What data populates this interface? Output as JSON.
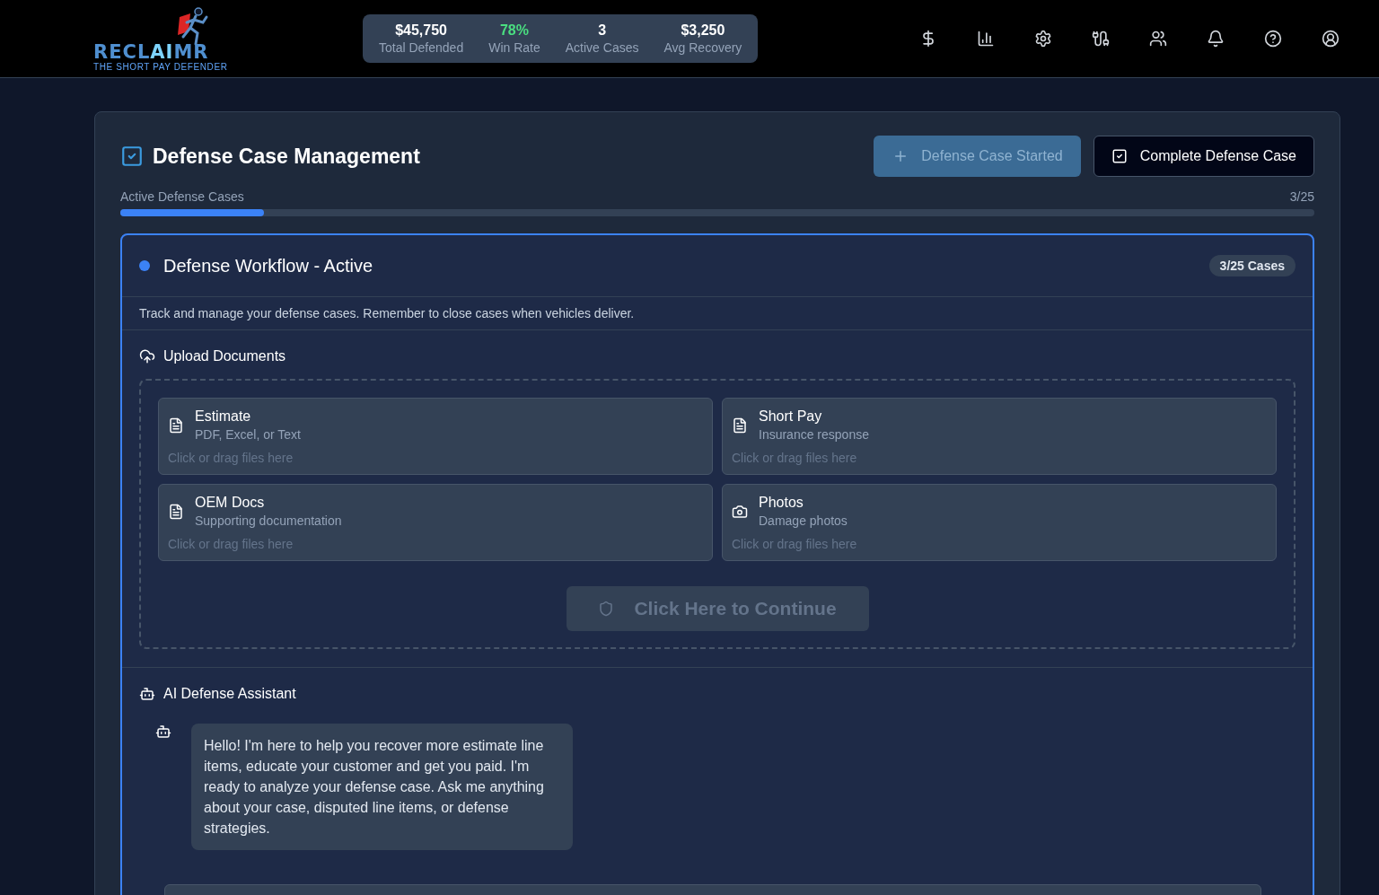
{
  "logo": {
    "word_parts": [
      {
        "text": "RECL",
        "accent": false
      },
      {
        "text": "AI",
        "accent": true
      },
      {
        "text": "MR",
        "accent": false
      }
    ],
    "tagline": "THE SHORT PAY DEFENDER"
  },
  "stats": [
    {
      "value": "$45,750",
      "label": "Total Defended",
      "color": "#ffffff"
    },
    {
      "value": "78%",
      "label": "Win Rate",
      "color": "#4ade80"
    },
    {
      "value": "3",
      "label": "Active Cases",
      "color": "#ffffff"
    },
    {
      "value": "$3,250",
      "label": "Avg Recovery",
      "color": "#ffffff"
    }
  ],
  "page": {
    "title": "Defense Case Management",
    "buttons": [
      {
        "kind": "add",
        "label": "Defense Case Started",
        "disabled": true
      },
      {
        "kind": "complete",
        "label": "Complete Defense Case",
        "disabled": false
      }
    ],
    "progress": {
      "label": "Active Defense Cases",
      "reading": "3/25",
      "level": 0.12
    }
  },
  "workflow": {
    "title": "Defense Workflow - Active",
    "badge": "3/25 Cases",
    "description": "Track and manage your defense cases. Remember to close cases when vehicles deliver.",
    "upload": {
      "title": "Upload Documents",
      "slots": [
        {
          "kind": "document",
          "title": "Estimate",
          "subtitle": "PDF, Excel, or Text",
          "hint": "Click or drag files here"
        },
        {
          "kind": "document",
          "title": "Short Pay",
          "subtitle": "Insurance response",
          "hint": "Click or drag files here"
        },
        {
          "kind": "document",
          "title": "OEM Docs",
          "subtitle": "Supporting documentation",
          "hint": "Click or drag files here"
        },
        {
          "kind": "camera",
          "title": "Photos",
          "subtitle": "Damage photos",
          "hint": "Click or drag files here"
        }
      ],
      "continue": {
        "label": "Click Here to Continue",
        "disabled": true
      }
    },
    "assistant": {
      "title": "AI Defense Assistant",
      "messages": [
        {
          "text": "Hello! I'm here to help you recover more estimate line items, educate your customer and get you paid. I'm ready to analyze your defense case. Ask me anything about your case, disputed line items, or defense strategies."
        }
      ]
    }
  }
}
